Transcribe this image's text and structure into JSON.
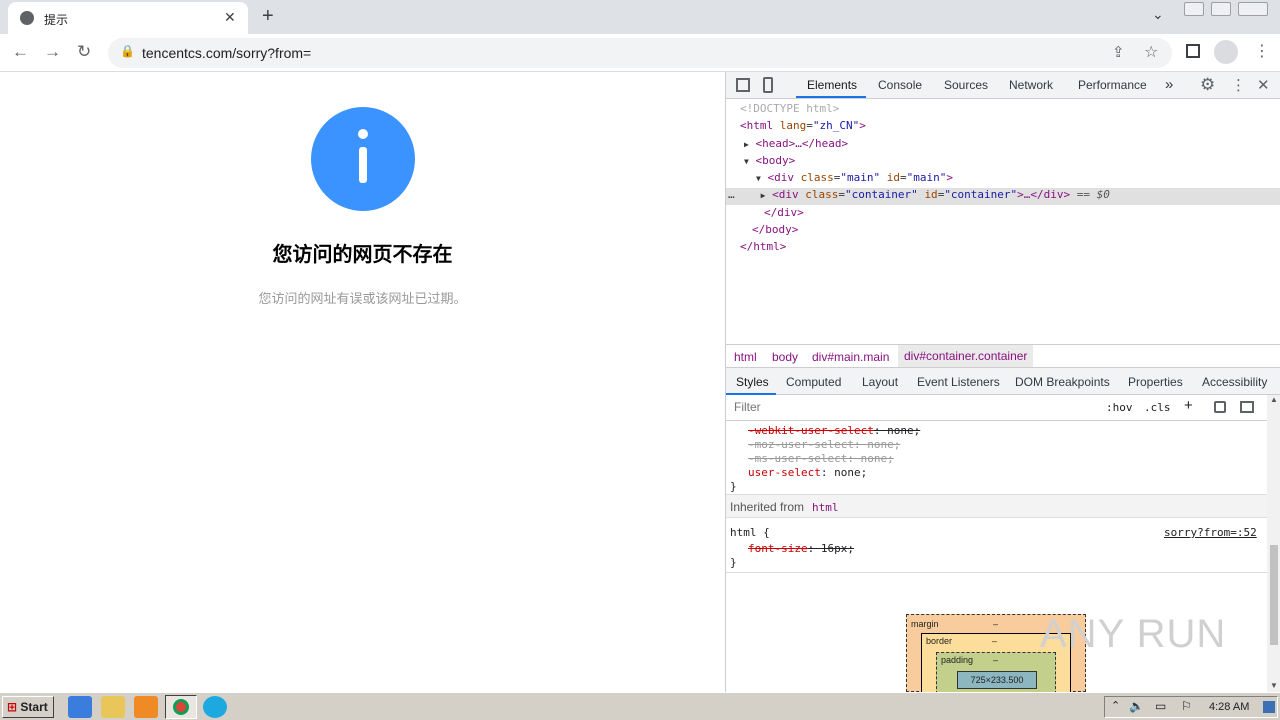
{
  "browser": {
    "tab_title": "提示",
    "tab_close": "✕",
    "new_tab": "+",
    "url": "tencentcs.com/sorry?from="
  },
  "page": {
    "heading": "您访问的网页不存在",
    "subtext": "您访问的网址有误或该网址已过期。",
    "info_color": "#3b93ff"
  },
  "devtools": {
    "tabs": [
      "Elements",
      "Console",
      "Sources",
      "Network",
      "Performance"
    ],
    "more": "»",
    "tree": {
      "doctype": "<!DOCTYPE html>",
      "html_open_tag": "<html",
      "lang_attr": "lang",
      "lang_value": "\"zh_CN\"",
      "close_bracket": ">",
      "head": "<head>…</head>",
      "body_open": "<body>",
      "div_open": "<div",
      "class_attr": "class",
      "id_attr": "id",
      "main_value": "\"main\"",
      "container_value": "\"container\"",
      "container_tail": ">…</div>",
      "selected_marker": "== $0",
      "div_close": "</div>",
      "body_close": "</body>",
      "html_close": "</html>",
      "dots": "…"
    },
    "breadcrumbs": [
      "html",
      "body",
      "div#main.main",
      "div#container.container"
    ],
    "style_tabs": [
      "Styles",
      "Computed",
      "Layout",
      "Event Listeners",
      "DOM Breakpoints",
      "Properties",
      "Accessibility"
    ],
    "filter_placeholder": "Filter",
    "hov": ":hov",
    "cls": ".cls",
    "styles": {
      "rule1": [
        {
          "prop": "-webkit-user-select",
          "value": "none;",
          "struck": true,
          "faded": false
        },
        {
          "prop": "-moz-user-select",
          "value": "none;",
          "struck": true,
          "faded": true
        },
        {
          "prop": "-ms-user-select",
          "value": "none;",
          "struck": true,
          "faded": true
        },
        {
          "prop": "user-select",
          "value": "none;",
          "struck": false,
          "faded": false
        }
      ],
      "rule1_close": "}",
      "inherited_label": "Inherited from",
      "inherited_tag": "html",
      "html_selector": "html {",
      "html_source": "sorry?from=:52",
      "html_prop": "font-size",
      "html_value": "16px;",
      "html_close": "}"
    },
    "box_model": {
      "margin_label": "margin",
      "border_label": "border",
      "padding_label": "padding",
      "dash": "–",
      "content_size": "725×233.500"
    }
  },
  "watermark": "ANY RUN",
  "taskbar": {
    "start_label": "Start",
    "clock": "4:28 AM"
  }
}
